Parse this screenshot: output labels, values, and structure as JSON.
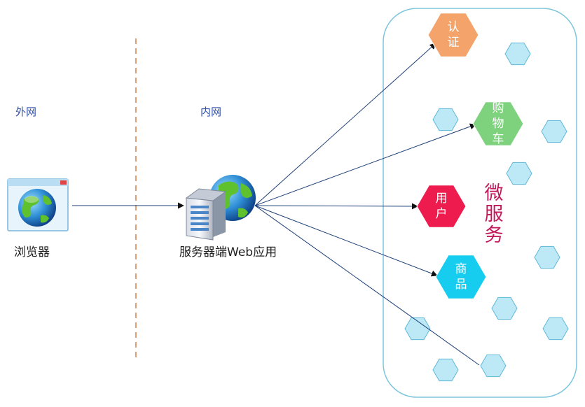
{
  "zones": {
    "external": "外网",
    "internal": "内网"
  },
  "nodes": {
    "browser": {
      "label": "浏览器",
      "icon": "browser-globe-icon"
    },
    "server": {
      "label": "服务器端Web应用",
      "icon": "server-globe-icon"
    }
  },
  "microservices": {
    "title": [
      "微",
      "服",
      "务"
    ],
    "services": [
      {
        "key": "auth",
        "chars": [
          "认",
          "证"
        ],
        "color": "#f4a46a"
      },
      {
        "key": "cart",
        "chars": [
          "购",
          "物",
          "车"
        ],
        "color": "#7ed27e"
      },
      {
        "key": "user",
        "chars": [
          "用",
          "户"
        ],
        "color": "#ee1c4e"
      },
      {
        "key": "goods",
        "chars": [
          "商",
          "品"
        ],
        "color": "#16cdf0"
      }
    ]
  },
  "colors": {
    "arrow": "#1c3f77",
    "divider": "#e0a077",
    "container_border": "#7ec6de",
    "small_hex": "#bde9f7",
    "small_hex_border": "#5fb8d6"
  }
}
